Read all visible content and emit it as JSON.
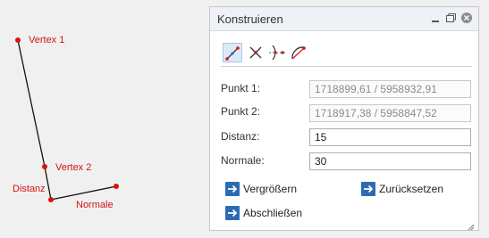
{
  "sketch": {
    "labels": {
      "vertex1": "Vertex 1",
      "vertex2": "Vertex 2",
      "distanz": "Distanz",
      "normale": "Normale"
    },
    "point_color": "#e01010",
    "line_color": "#111111"
  },
  "panel": {
    "title": "Konstruieren",
    "window_icons": [
      "minimize-icon",
      "restore-icon",
      "close-icon"
    ],
    "tools": [
      "construct-line-icon",
      "intersection-icon",
      "parallel-icon",
      "arc-construct-icon"
    ],
    "fields": [
      {
        "label": "Punkt 1:",
        "value": "1718899,61 / 5958932,91",
        "readonly": true
      },
      {
        "label": "Punkt 2:",
        "value": "1718917,38 / 5958847,52",
        "readonly": true
      },
      {
        "label": "Distanz:",
        "value": "15",
        "readonly": false
      },
      {
        "label": "Normale:",
        "value": "30",
        "readonly": false
      }
    ],
    "actions": {
      "enlarge": "Vergrößern",
      "reset": "Zurücksetzen",
      "finish": "Abschließen"
    },
    "accent": "#2b6cb5"
  }
}
